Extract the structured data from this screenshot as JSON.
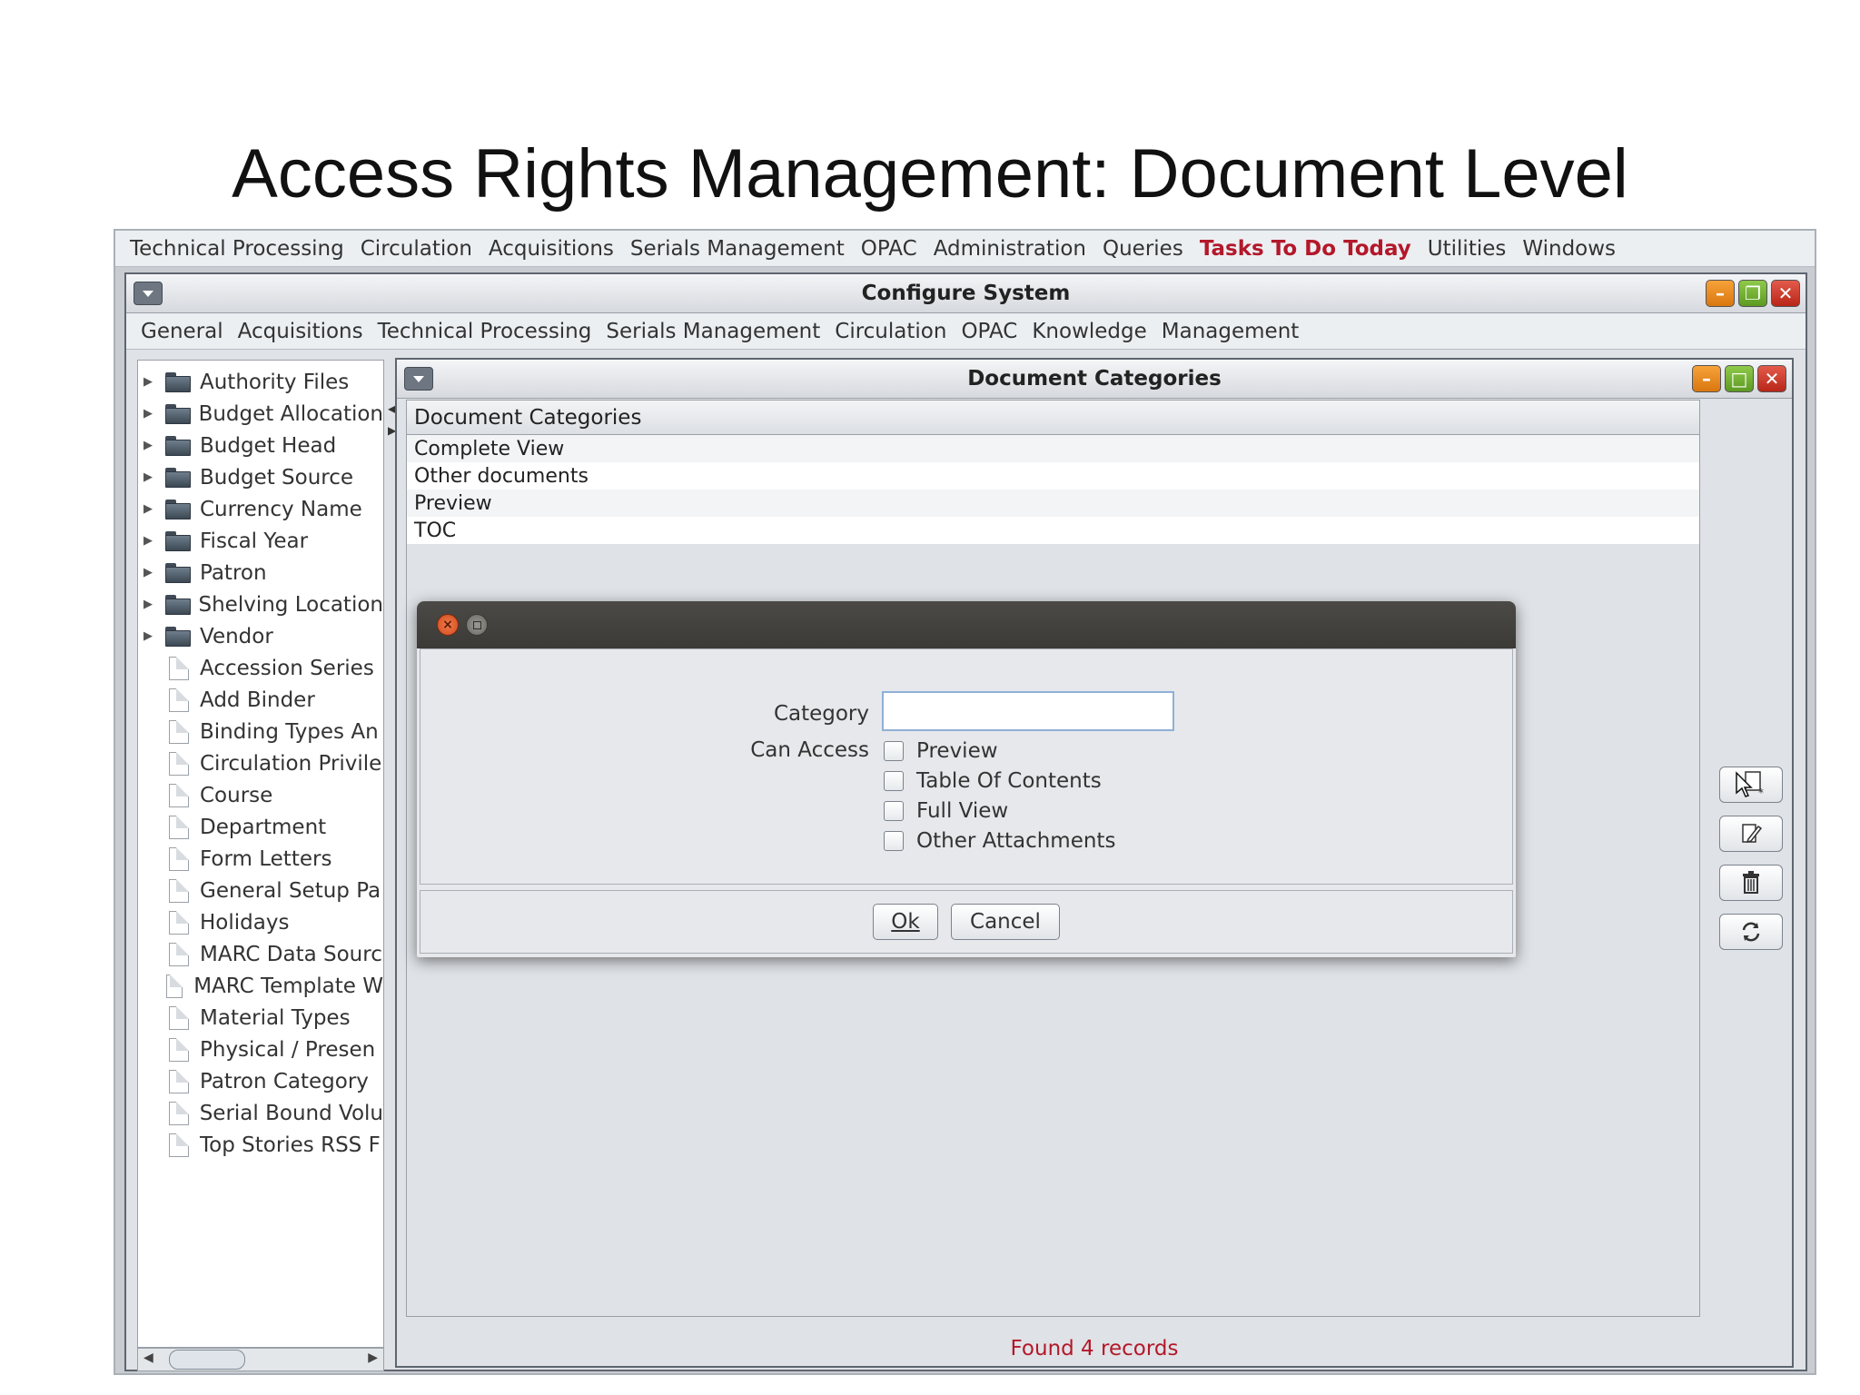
{
  "slide_title": "Access Rights Management: Document Level",
  "main_menu": [
    "Technical Processing",
    "Circulation",
    "Acquisitions",
    "Serials Management",
    "OPAC",
    "Administration",
    "Queries",
    "Tasks To Do Today",
    "Utilities",
    "Windows"
  ],
  "main_menu_highlight": "Tasks To Do Today",
  "outer_window": {
    "title": "Configure System"
  },
  "sub_menu": [
    "General",
    "Acquisitions",
    "Technical Processing",
    "Serials Management",
    "Circulation",
    "OPAC",
    "Knowledge",
    "Management"
  ],
  "tree": {
    "folders": [
      "Authority Files",
      "Budget Allocation",
      "Budget Head",
      "Budget Source",
      "Currency Name",
      "Fiscal Year",
      "Patron",
      "Shelving Location",
      "Vendor"
    ],
    "documents": [
      "Accession Series",
      "Add Binder",
      "Binding Types An",
      "Circulation Privile",
      "Course",
      "Department",
      "Form Letters",
      "General Setup Pa",
      "Holidays",
      "MARC Data Sourc",
      "MARC Template W",
      "Material Types",
      "Physical / Presen",
      "Patron Category",
      "Serial Bound Volu",
      "Top Stories RSS F"
    ]
  },
  "inner_window": {
    "title": "Document Categories",
    "table": {
      "header": "Document Categories",
      "rows": [
        "Complete View",
        "Other documents",
        "Preview",
        "TOC"
      ]
    },
    "status": "Found 4 records",
    "side_buttons": [
      "new-record-icon",
      "edit-icon",
      "trash-icon",
      "refresh-icon"
    ]
  },
  "dialog": {
    "category_label": "Category",
    "category_value": "",
    "can_access_label": "Can Access",
    "options": [
      {
        "label": "Preview",
        "checked": false
      },
      {
        "label": "Table Of Contents",
        "checked": false
      },
      {
        "label": "Full View",
        "checked": false
      },
      {
        "label": "Other Attachments",
        "checked": false
      }
    ],
    "ok_label": "Ok",
    "cancel_label": "Cancel"
  },
  "colors": {
    "highlight_red": "#b3182a",
    "window_bg": "#dfe2e6",
    "dialog_titlebar": "#3b3a36"
  }
}
